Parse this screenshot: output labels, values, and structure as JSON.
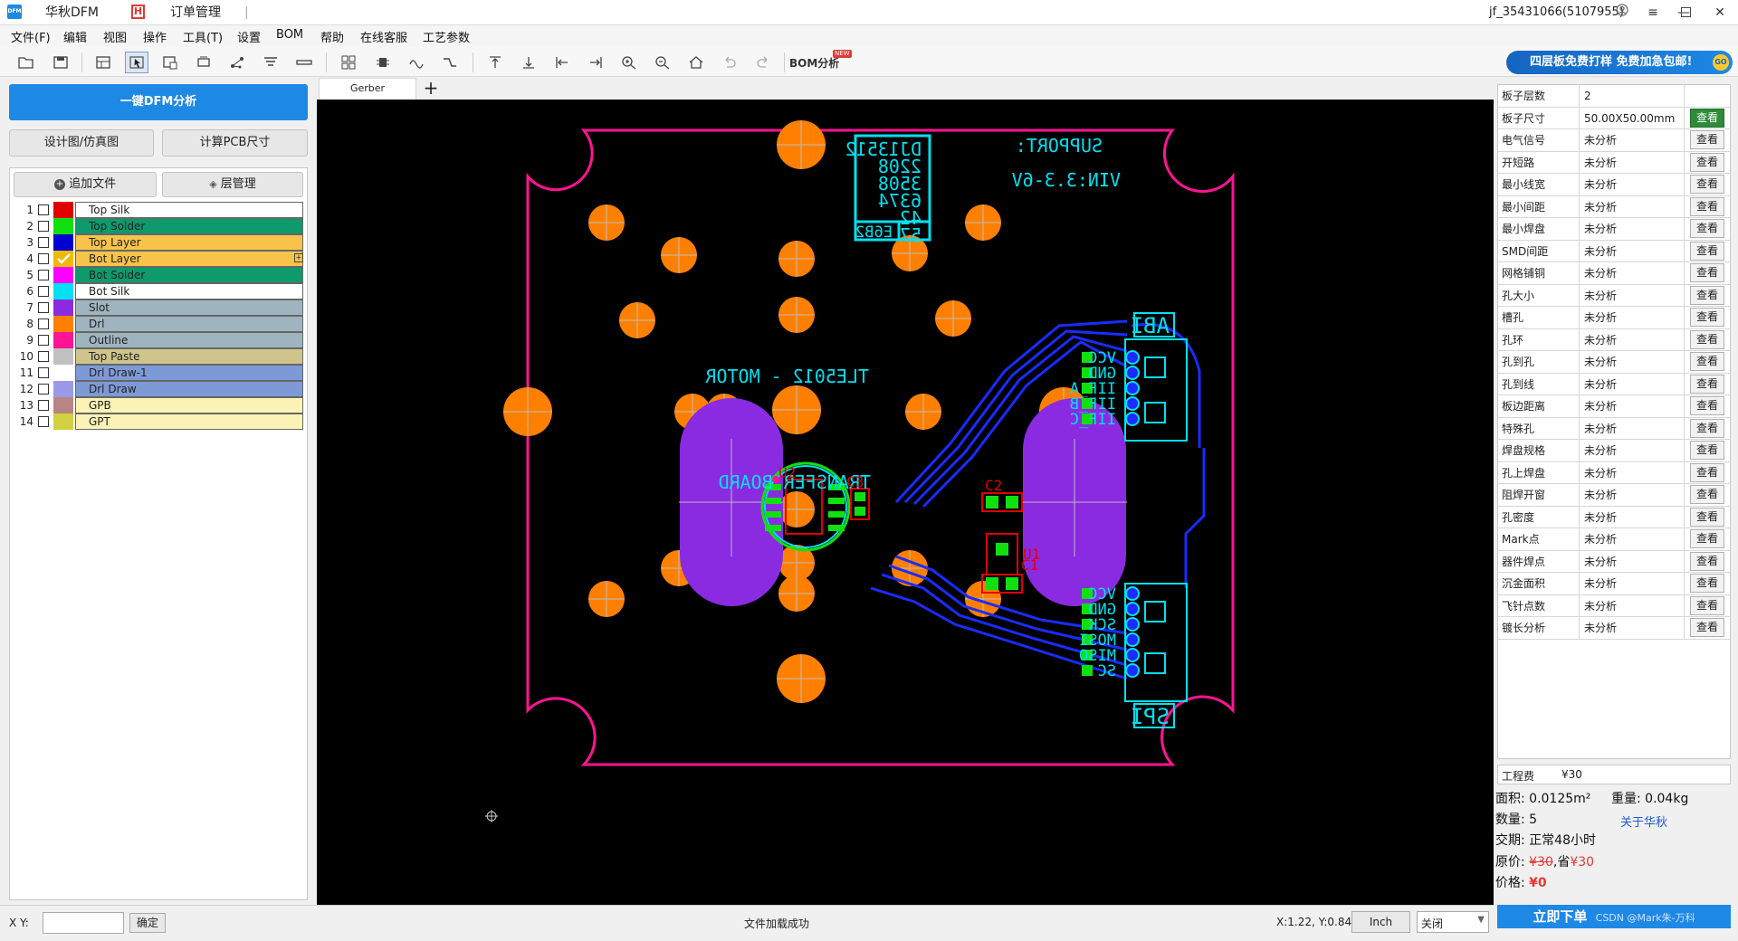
{
  "titlebar": {
    "app_tab": "华秋DFM",
    "order_tab": "订单管理",
    "separator": "|",
    "user": "jf_35431066(5107955)",
    "logo_text": "DFM",
    "h_badge": "H"
  },
  "menu": [
    "文件(F)",
    "编辑",
    "视图",
    "操作",
    "工具(T)",
    "设置",
    "BOM",
    "帮助",
    "在线客服",
    "工艺参数"
  ],
  "toolbar": {
    "bom_label": "BOM分析",
    "bom_badge": "NEW",
    "ad_text": "四层板免费打样 免费加急包邮!",
    "ad_badge": "GO"
  },
  "left": {
    "dfm_button": "一键DFM分析",
    "design_button": "设计图/仿真图",
    "calc_button": "计算PCB尺寸",
    "add_file_button": "追加文件",
    "layer_mgmt_button": "层管理",
    "layers": [
      {
        "num": "1",
        "name": "Top Silk",
        "color": "#e10000",
        "bg": "#ffffff"
      },
      {
        "num": "2",
        "name": "Top Solder",
        "color": "#10e010",
        "bg": "#0e9a6c"
      },
      {
        "num": "3",
        "name": "Top Layer",
        "color": "#0000d0",
        "bg": "#f7c34a"
      },
      {
        "num": "4",
        "name": "Bot Layer",
        "color": "#f0b800",
        "bg": "#f7c34a",
        "checked": true
      },
      {
        "num": "5",
        "name": "Bot Solder",
        "color": "#ff00ff",
        "bg": "#0e9a6c"
      },
      {
        "num": "6",
        "name": "Bot Silk",
        "color": "#00e0f0",
        "bg": "#ffffff"
      },
      {
        "num": "7",
        "name": "Slot",
        "color": "#8a2be2",
        "bg": "#9eb4bf"
      },
      {
        "num": "8",
        "name": "Drl",
        "color": "#ff8000",
        "bg": "#9eb4bf"
      },
      {
        "num": "9",
        "name": "Outline",
        "color": "#ff1493",
        "bg": "#9eb4bf"
      },
      {
        "num": "10",
        "name": "Top Paste",
        "color": "#c0c0c0",
        "bg": "#cfc58c"
      },
      {
        "num": "11",
        "name": "Drl Draw-1",
        "color": "#ffffff",
        "bg": "#7e9ad6"
      },
      {
        "num": "12",
        "name": "Drl Draw",
        "color": "#9a9ae8",
        "bg": "#7e9ad6"
      },
      {
        "num": "13",
        "name": "GPB",
        "color": "#b88585",
        "bg": "#fbf3b5"
      },
      {
        "num": "14",
        "name": "GPT",
        "color": "#d0d040",
        "bg": "#fbf3b5"
      }
    ]
  },
  "canvas": {
    "tab": "Gerber",
    "add_tab": "+",
    "silk": {
      "support": "SUPPORT:",
      "code_lines": [
        "DJ13512",
        "2208",
        "3508",
        "6374",
        "42",
        "57"
      ],
      "code_suffix": "E6B2",
      "vin": "VIN:3.3-6V",
      "motor": "TLE5012 - MOTOR",
      "transfer": "TRANSFER BOARD",
      "abi": "ABI",
      "spi": "SPI",
      "abi_pins": [
        "VCC",
        "GND",
        "IIF_A",
        "IIF_B",
        "IIF_C"
      ],
      "spi_pins": [
        "VCC",
        "GND",
        "SCK",
        "MOSI",
        "MISO",
        "SC"
      ],
      "refs": [
        "U2",
        "C3",
        "C2",
        "U1",
        "C1"
      ]
    }
  },
  "right": {
    "rows": [
      {
        "k": "板子层数",
        "v": "2",
        "btn": ""
      },
      {
        "k": "板子尺寸",
        "v": "50.00X50.00mm",
        "btn": "查看",
        "green": true
      },
      {
        "k": "电气信号",
        "v": "未分析",
        "btn": "查看"
      },
      {
        "k": "开短路",
        "v": "未分析",
        "btn": "查看"
      },
      {
        "k": "最小线宽",
        "v": "未分析",
        "btn": "查看"
      },
      {
        "k": "最小间距",
        "v": "未分析",
        "btn": "查看"
      },
      {
        "k": "最小焊盘",
        "v": "未分析",
        "btn": "查看"
      },
      {
        "k": "SMD间距",
        "v": "未分析",
        "btn": "查看"
      },
      {
        "k": "网格铺铜",
        "v": "未分析",
        "btn": "查看"
      },
      {
        "k": "孔大小",
        "v": "未分析",
        "btn": "查看"
      },
      {
        "k": "槽孔",
        "v": "未分析",
        "btn": "查看"
      },
      {
        "k": "孔环",
        "v": "未分析",
        "btn": "查看"
      },
      {
        "k": "孔到孔",
        "v": "未分析",
        "btn": "查看"
      },
      {
        "k": "孔到线",
        "v": "未分析",
        "btn": "查看"
      },
      {
        "k": "板边距离",
        "v": "未分析",
        "btn": "查看"
      },
      {
        "k": "特殊孔",
        "v": "未分析",
        "btn": "查看"
      },
      {
        "k": "焊盘规格",
        "v": "未分析",
        "btn": "查看"
      },
      {
        "k": "孔上焊盘",
        "v": "未分析",
        "btn": "查看"
      },
      {
        "k": "阻焊开窗",
        "v": "未分析",
        "btn": "查看"
      },
      {
        "k": "孔密度",
        "v": "未分析",
        "btn": "查看"
      },
      {
        "k": "Mark点",
        "v": "未分析",
        "btn": "查看"
      },
      {
        "k": "器件焊点",
        "v": "未分析",
        "btn": "查看"
      },
      {
        "k": "沉金面积",
        "v": "未分析",
        "btn": "查看"
      },
      {
        "k": "飞针点数",
        "v": "未分析",
        "btn": "查看"
      },
      {
        "k": "镀长分析",
        "v": "未分析",
        "btn": "查看"
      }
    ],
    "fee_label": "工程费",
    "fee_value": "¥30",
    "area_label": "面积:",
    "area_value": "0.0125m²",
    "weight_label": "重量:",
    "weight_value": "0.04kg",
    "qty_label": "数量:",
    "qty_value": "5",
    "about_link": "关于华秋",
    "delivery_label": "交期:",
    "delivery_value": "正常48小时",
    "orig_label": "原价:",
    "orig_value": "¥30",
    "save_label": ",省",
    "save_value": "¥30",
    "price_label": "价格:",
    "price_value": "¥0",
    "order_button": "立即下单",
    "watermark": "CSDN @Mark朱-万科"
  },
  "status": {
    "xy_label": "X Y:",
    "xy_value": "",
    "confirm_button": "确定",
    "message": "文件加载成功",
    "coords": "X:1.22, Y:0.84",
    "unit_button": "Inch",
    "select_value": "关闭"
  }
}
